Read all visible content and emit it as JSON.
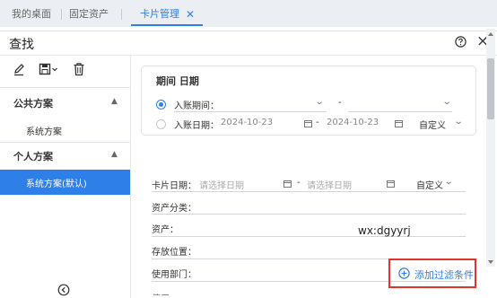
{
  "tabs": [
    {
      "label": "我的桌面"
    },
    {
      "label": "固定资产"
    },
    {
      "label": "卡片管理",
      "active": true
    }
  ],
  "tab_close": "✕",
  "dialog": {
    "title": "查找"
  },
  "sidebar": {
    "toolbar": [
      "edit-icon",
      "save-icon",
      "delete-icon"
    ],
    "public_section": {
      "title": "公共方案",
      "items": [
        "系统方案"
      ]
    },
    "private_section": {
      "title": "个人方案",
      "items": [
        "系统方案(默认)"
      ]
    }
  },
  "period_card": {
    "title": "期间 日期",
    "period_row": {
      "label": "入账期间：",
      "dash": "-",
      "selected": true
    },
    "date_row": {
      "label": "入账日期：",
      "start": "2024-10-23",
      "dash": "-",
      "end": "2024-10-23",
      "mode": "自定义",
      "selected": false
    }
  },
  "fields": {
    "card_date": {
      "label": "卡片日期：",
      "start_placeholder": "请选择日期",
      "dash": "-",
      "end_placeholder": "请选择日期",
      "mode": "自定义"
    },
    "asset_category": {
      "label": "资产分类："
    },
    "asset": {
      "label": "资产："
    },
    "location": {
      "label": "存放位置："
    },
    "department": {
      "label": "使用部门："
    }
  },
  "watermark": "wx:dgyyrj",
  "add_filter": {
    "label": "添加过滤条件"
  },
  "colors": {
    "accent": "#2f7fe8",
    "highlight_border": "#e0352b"
  }
}
